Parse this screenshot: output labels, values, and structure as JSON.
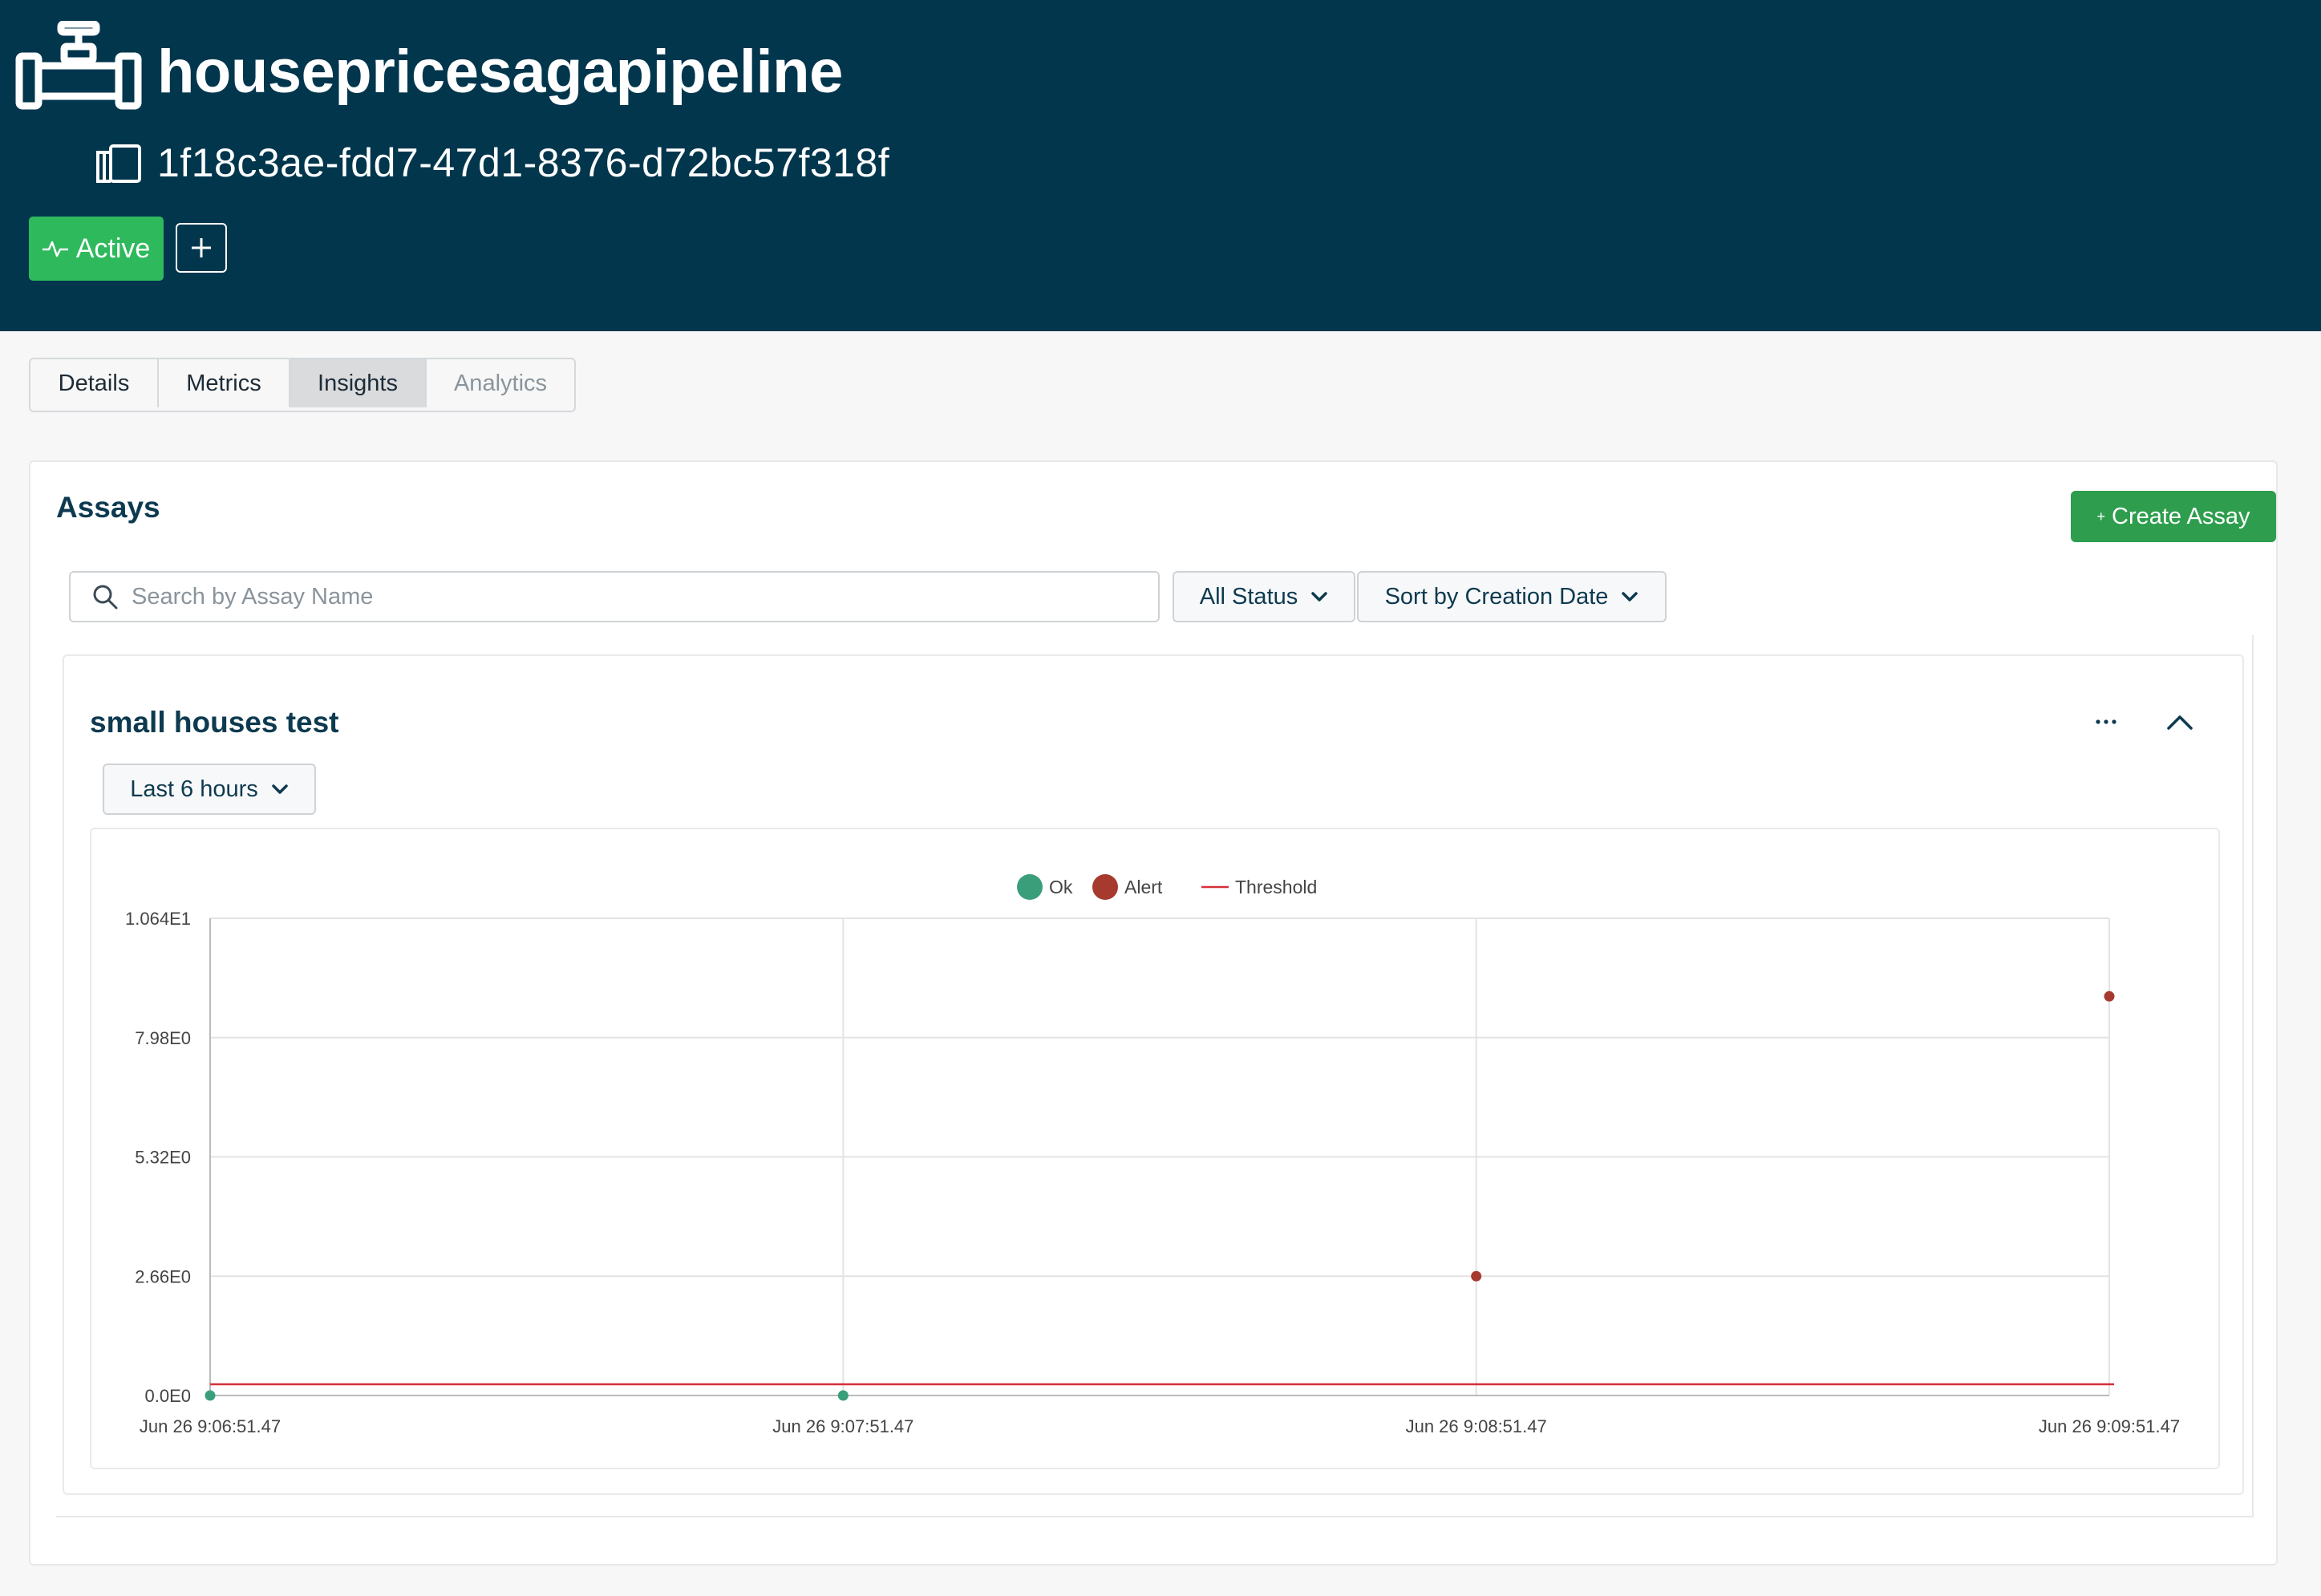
{
  "header": {
    "title": "housepricesagapipeline",
    "pipeline_id": "1f18c3ae-fdd7-47d1-8376-d72bc57f318f",
    "status_label": "Active",
    "add_label": "+",
    "icons": [
      "pipe-icon",
      "copy-icon",
      "activity-icon",
      "plus-icon"
    ]
  },
  "tabs": [
    {
      "label": "Details"
    },
    {
      "label": "Metrics"
    },
    {
      "label": "Insights",
      "selected": true
    },
    {
      "label": "Analytics",
      "disabled": true
    }
  ],
  "assays": {
    "title": "Assays",
    "create_label": "Create Assay",
    "create_prefix": "+",
    "search_placeholder": "Search by Assay Name",
    "status_filter": "All Status",
    "sort_label": "Sort by Creation Date",
    "items": [
      {
        "name": "small houses test",
        "range_label": "Last 6 hours"
      }
    ]
  },
  "colors": {
    "header_bg": "#01364d",
    "active_green": "#2fb95d",
    "create_green": "#2e9e4e",
    "ok": "#3a9e7a",
    "alert": "#a63a2f",
    "threshold": "#d6303a"
  },
  "chart_data": {
    "type": "scatter",
    "legend": [
      {
        "name": "Ok",
        "marker": "circle",
        "color": "#3a9e7a"
      },
      {
        "name": "Alert",
        "marker": "circle",
        "color": "#a63a2f"
      },
      {
        "name": "Threshold",
        "marker": "line",
        "color": "#d6303a"
      }
    ],
    "legend_position": "top-center",
    "x_ticks": [
      "Jun 26 9:06:51.47",
      "Jun 26 9:07:51.47",
      "Jun 26 9:08:51.47",
      "Jun 26 9:09:51.47"
    ],
    "y_ticks": [
      "1.064E1",
      "7.98E0",
      "5.32E0",
      "2.66E0",
      "0.0E0"
    ],
    "ylim": [
      0,
      10.64
    ],
    "series": [
      {
        "name": "Ok",
        "points": [
          {
            "x": "Jun 26 9:06:51.47",
            "y": 0
          },
          {
            "x": "Jun 26 9:07:51.47",
            "y": 0
          }
        ]
      },
      {
        "name": "Alert",
        "points": [
          {
            "x": "Jun 26 9:08:51.47",
            "y": 2.66
          },
          {
            "x": "Jun 26 9:09:51.47",
            "y": 8.9
          }
        ]
      },
      {
        "name": "Threshold",
        "value": 0.25
      }
    ],
    "grid": true
  }
}
